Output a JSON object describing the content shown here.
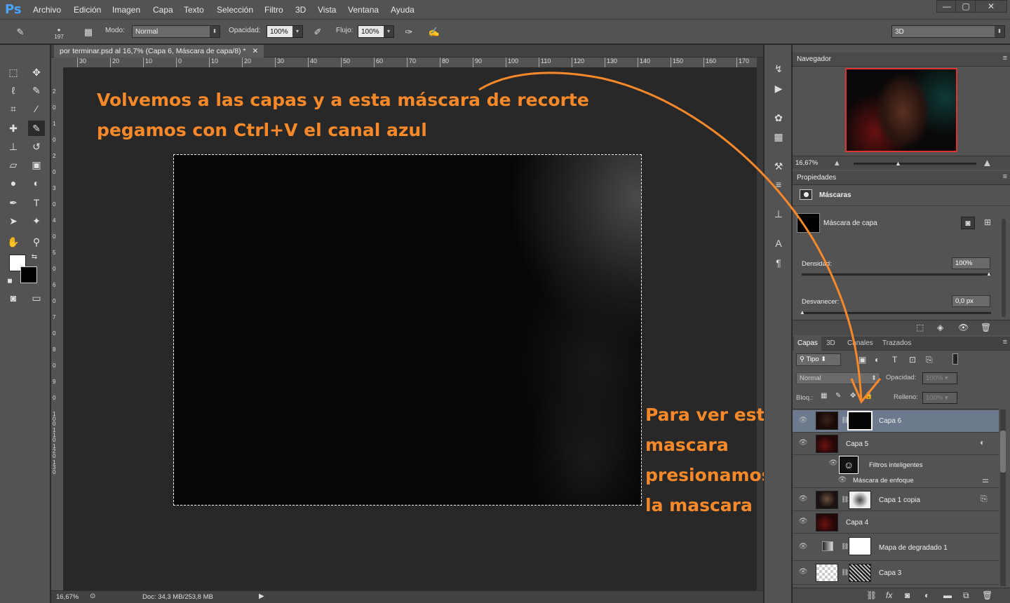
{
  "app": {
    "logo": "Ps"
  },
  "menu": [
    "Archivo",
    "Edición",
    "Imagen",
    "Capa",
    "Texto",
    "Selección",
    "Filtro",
    "3D",
    "Vista",
    "Ventana",
    "Ayuda"
  ],
  "window_controls": [
    "—",
    "▢",
    "✕"
  ],
  "options": {
    "brush_size": "197",
    "mode_label": "Modo:",
    "mode_value": "Normal",
    "opacity_label": "Opacidad:",
    "opacity_value": "100%",
    "flow_label": "Flujo:",
    "flow_value": "100%",
    "workspace": "3D"
  },
  "document": {
    "tab_title": "por terminar.psd al 16,7% (Capa 6, Máscara de capa/8) *",
    "zoom": "16,67%",
    "doc_info": "Doc: 34,3 MB/253,8 MB"
  },
  "ruler_h_ticks": [
    "30",
    "20",
    "10",
    "0",
    "10",
    "20",
    "30",
    "40",
    "50",
    "60",
    "70",
    "80",
    "90",
    "100",
    "110",
    "120",
    "130",
    "140",
    "150",
    "160",
    "170"
  ],
  "ruler_v_ticks": [
    "2",
    "0",
    "1",
    "0",
    "2",
    "0",
    "3",
    "0",
    "4",
    "0",
    "5",
    "0",
    "6",
    "0",
    "7",
    "0",
    "8",
    "0",
    "9",
    "0",
    "1 0 0",
    "1 1 0",
    "1 2 0",
    "1 3 0"
  ],
  "annotations": {
    "top_line1": "Volvemos a las capas y a esta máscara de recorte",
    "top_line2": "pegamos con Ctrl+V el canal azul",
    "right_line1": "Para ver esta",
    "right_line2": "mascara",
    "right_line3": "presionamos Alt y",
    "right_line4": "la mascara",
    "color": "#f7892a"
  },
  "navigator": {
    "title": "Navegador",
    "zoom": "16,67%"
  },
  "properties": {
    "title": "Propiedades",
    "section": "Máscaras",
    "mask_label": "Máscara de capa",
    "density_label": "Densidad:",
    "density_value": "100%",
    "feather_label": "Desvanecer:",
    "feather_value": "0,0 px"
  },
  "layers_panel": {
    "tabs": [
      "Capas",
      "3D",
      "Canales",
      "Trazados"
    ],
    "filter_kind": "Tipo",
    "blend_mode": "Normal",
    "opacity_label": "Opacidad:",
    "opacity_value": "100%",
    "lock_label": "Bloq.:",
    "fill_label": "Relleno:",
    "fill_value": "100%",
    "layers": [
      {
        "name": "Capa 6"
      },
      {
        "name": "Capa 5"
      },
      {
        "name": "Filtros inteligentes"
      },
      {
        "name": "Máscara de enfoque"
      },
      {
        "name": "Capa 1 copia"
      },
      {
        "name": "Capa 4"
      },
      {
        "name": "Mapa de degradado 1"
      },
      {
        "name": "Capa 3"
      }
    ],
    "footer_icons": [
      "link-icon",
      "fx-icon",
      "mask-icon",
      "adjustment-icon",
      "folder-icon",
      "new-layer-icon",
      "trash-icon"
    ]
  }
}
